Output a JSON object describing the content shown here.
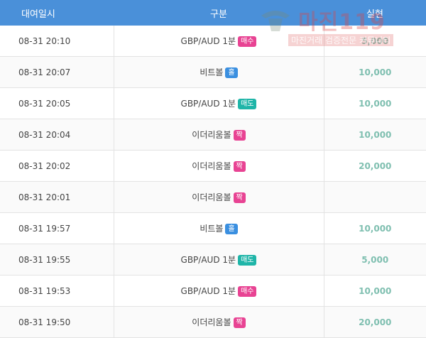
{
  "headers": {
    "time": "대여일시",
    "type": "구분",
    "amount": "실현"
  },
  "rows": [
    {
      "time": "08-31 20:10",
      "type": "GBP/AUD 1분",
      "badge": "매수",
      "badge_kind": "buy",
      "amount": "5,000"
    },
    {
      "time": "08-31 20:07",
      "type": "비트볼",
      "badge": "홀",
      "badge_kind": "odd",
      "amount": "10,000"
    },
    {
      "time": "08-31 20:05",
      "type": "GBP/AUD 1분",
      "badge": "매도",
      "badge_kind": "sell",
      "amount": "10,000"
    },
    {
      "time": "08-31 20:04",
      "type": "이더리움볼",
      "badge": "짝",
      "badge_kind": "even",
      "amount": "10,000"
    },
    {
      "time": "08-31 20:02",
      "type": "이더리움볼",
      "badge": "짝",
      "badge_kind": "even",
      "amount": "20,000"
    },
    {
      "time": "08-31 20:01",
      "type": "이더리움볼",
      "badge": "짝",
      "badge_kind": "even",
      "amount": ""
    },
    {
      "time": "08-31 19:57",
      "type": "비트볼",
      "badge": "홀",
      "badge_kind": "odd",
      "amount": "10,000"
    },
    {
      "time": "08-31 19:55",
      "type": "GBP/AUD 1분",
      "badge": "매도",
      "badge_kind": "sell",
      "amount": "5,000"
    },
    {
      "time": "08-31 19:53",
      "type": "GBP/AUD 1분",
      "badge": "매수",
      "badge_kind": "buy",
      "amount": "10,000"
    },
    {
      "time": "08-31 19:50",
      "type": "이더리움볼",
      "badge": "짝",
      "badge_kind": "even",
      "amount": "20,000"
    }
  ],
  "watermark": {
    "title": "마진119",
    "subtitle": "마진거래 검증전문 커뮤니티"
  },
  "colors": {
    "header_bg": "#4a90d9",
    "amount": "#7fbfb0",
    "buy": "#e84393",
    "sell": "#1fb5a8",
    "odd": "#3a8fe0"
  }
}
